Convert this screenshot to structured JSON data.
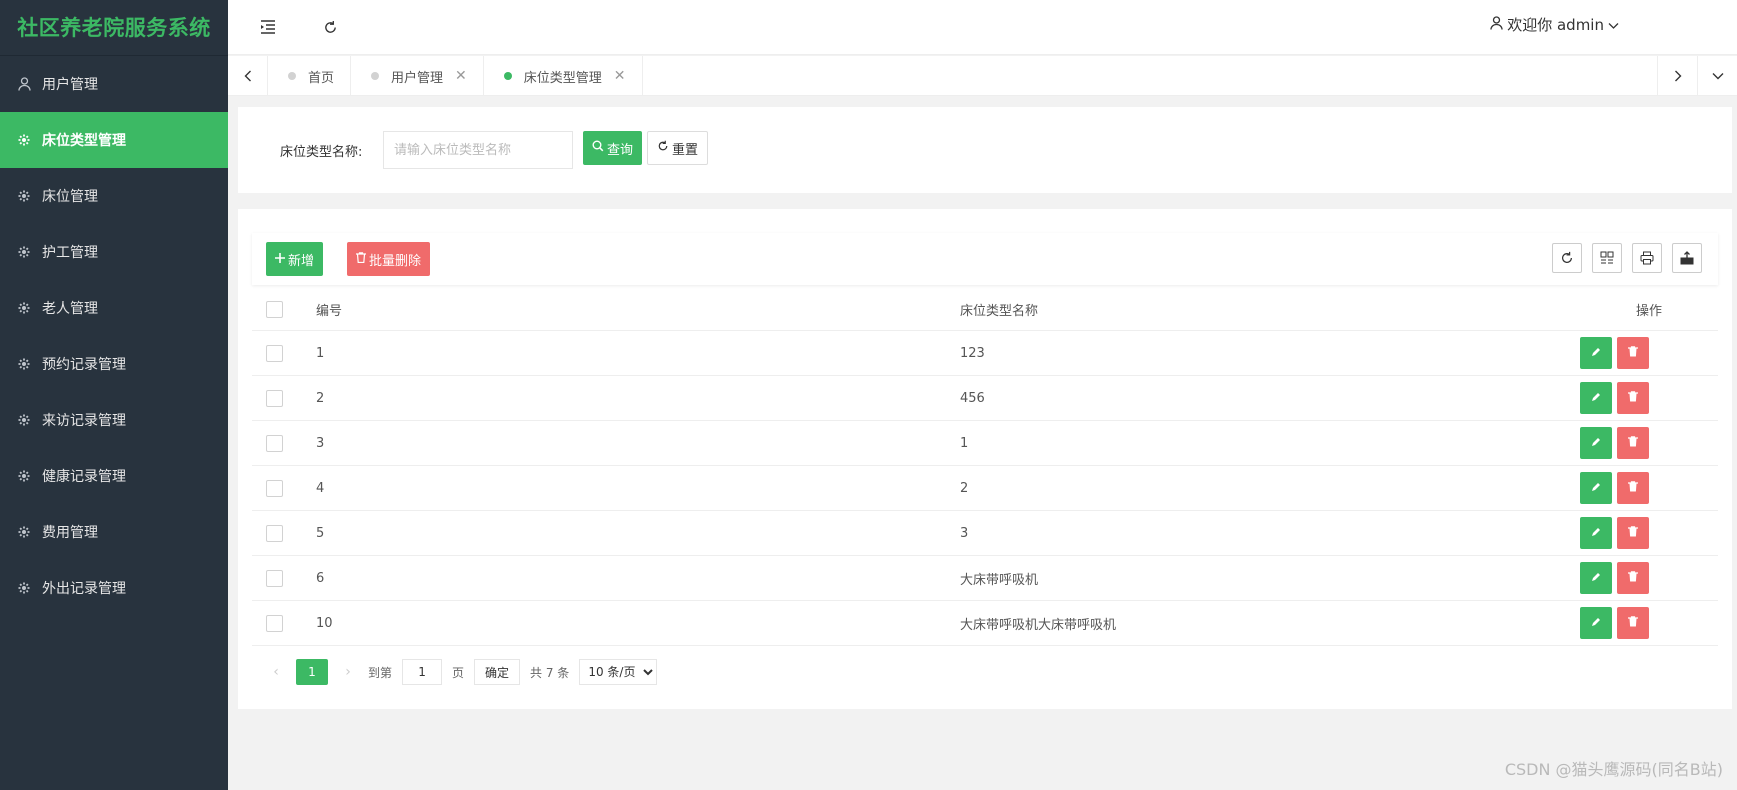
{
  "app": {
    "title": "社区养老院服务系统"
  },
  "sidebar": {
    "items": [
      {
        "label": "用户管理",
        "icon": "user-icon",
        "active": false
      },
      {
        "label": "床位类型管理",
        "icon": "gear-icon",
        "active": true
      },
      {
        "label": "床位管理",
        "icon": "gear-icon",
        "active": false
      },
      {
        "label": "护工管理",
        "icon": "gear-icon",
        "active": false
      },
      {
        "label": "老人管理",
        "icon": "gear-icon",
        "active": false
      },
      {
        "label": "预约记录管理",
        "icon": "gear-icon",
        "active": false
      },
      {
        "label": "来访记录管理",
        "icon": "gear-icon",
        "active": false
      },
      {
        "label": "健康记录管理",
        "icon": "gear-icon",
        "active": false
      },
      {
        "label": "费用管理",
        "icon": "gear-icon",
        "active": false
      },
      {
        "label": "外出记录管理",
        "icon": "gear-icon",
        "active": false
      }
    ]
  },
  "header": {
    "user_label": "欢迎你 admin"
  },
  "tabs": [
    {
      "label": "首页",
      "closable": false,
      "active": false
    },
    {
      "label": "用户管理",
      "closable": true,
      "active": false
    },
    {
      "label": "床位类型管理",
      "closable": true,
      "active": true
    }
  ],
  "search": {
    "label": "床位类型名称:",
    "placeholder": "请输入床位类型名称",
    "query_label": "查询",
    "reset_label": "重置"
  },
  "toolbar": {
    "add_label": "新增",
    "batch_delete_label": "批量删除"
  },
  "table": {
    "columns": {
      "id": "编号",
      "name": "床位类型名称",
      "op": "操作"
    },
    "rows": [
      {
        "id": "1",
        "name": "123"
      },
      {
        "id": "2",
        "name": "456"
      },
      {
        "id": "3",
        "name": "1"
      },
      {
        "id": "4",
        "name": "2"
      },
      {
        "id": "5",
        "name": "3"
      },
      {
        "id": "6",
        "name": "大床带呼吸机"
      },
      {
        "id": "10",
        "name": "大床带呼吸机大床带呼吸机"
      }
    ]
  },
  "pager": {
    "current": "1",
    "goto_prefix": "到第",
    "goto_value": "1",
    "goto_suffix": "页",
    "confirm_label": "确定",
    "total_label": "共 7 条",
    "page_size": "10 条/页"
  },
  "watermark": "CSDN @猫头鹰源码(同名B站)",
  "colors": {
    "accent": "#3cb964",
    "danger": "#f06b6b",
    "sidebar_bg": "#28333e"
  }
}
